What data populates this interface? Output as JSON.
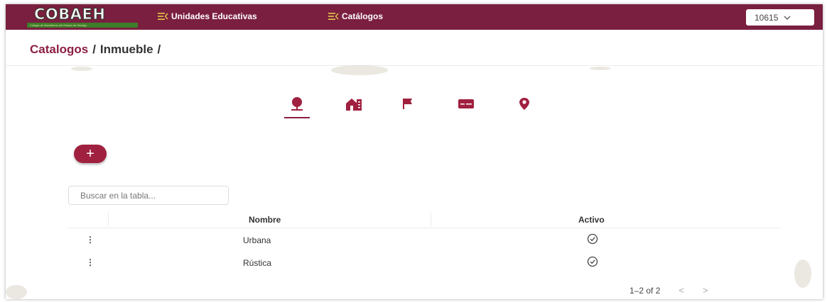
{
  "header": {
    "logo_text": "COBAEH",
    "logo_subtext": "Colegio de Bachilleres del Estado de Hidalgo",
    "nav": [
      {
        "label": "Unidades Educativas",
        "icon": "menu-collapse-icon"
      },
      {
        "label": "Catálogos",
        "icon": "menu-collapse-icon"
      }
    ],
    "user_select": {
      "value": "10615",
      "icon": "chevron-down-icon"
    }
  },
  "breadcrumb": {
    "items": [
      "Catalogos",
      "Inmueble"
    ],
    "separator": "/"
  },
  "icon_tabs": [
    {
      "icon": "map-pin-tree-icon",
      "active": true
    },
    {
      "icon": "building-icon",
      "active": false
    },
    {
      "icon": "flag-icon",
      "active": false
    },
    {
      "icon": "id-card-icon",
      "active": false
    },
    {
      "icon": "location-pin-icon",
      "active": false
    }
  ],
  "add_button": {
    "label": "+"
  },
  "search": {
    "placeholder": "Buscar en la tabla..."
  },
  "table": {
    "columns": [
      "Nombre",
      "Activo"
    ],
    "rows": [
      {
        "menu": "⋮",
        "nombre": "Urbana",
        "activo": true
      },
      {
        "menu": "⋮",
        "nombre": "Rústica",
        "activo": true
      }
    ]
  },
  "pagination": {
    "range": "1–2 of 2",
    "prev": "<",
    "next": ">"
  },
  "colors": {
    "primary": "#7a1f3f",
    "accent": "#a0203f",
    "logo_green": "#3e7d2a"
  }
}
